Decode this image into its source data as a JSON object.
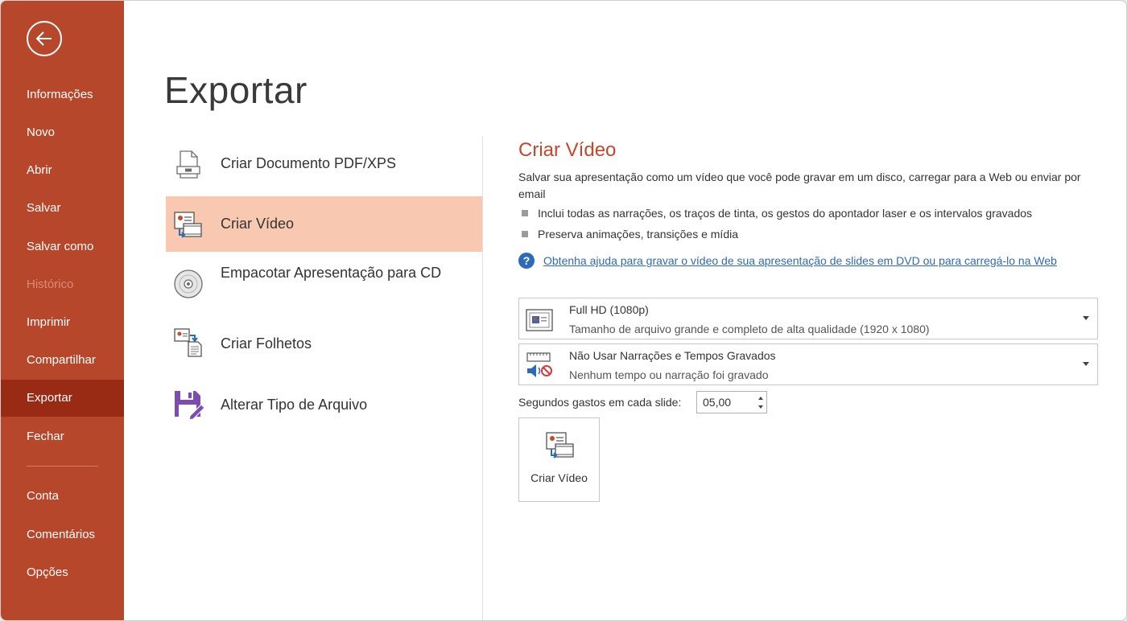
{
  "sidebar": {
    "items": [
      {
        "label": "Informações",
        "state": "normal"
      },
      {
        "label": "Novo",
        "state": "normal"
      },
      {
        "label": "Abrir",
        "state": "normal"
      },
      {
        "label": "Salvar",
        "state": "normal"
      },
      {
        "label": "Salvar como",
        "state": "normal"
      },
      {
        "label": "Histórico",
        "state": "disabled"
      },
      {
        "label": "Imprimir",
        "state": "normal"
      },
      {
        "label": "Compartilhar",
        "state": "normal"
      },
      {
        "label": "Exportar",
        "state": "active"
      },
      {
        "label": "Fechar",
        "state": "normal"
      },
      {
        "label": "Conta",
        "state": "normal"
      },
      {
        "label": "Comentários",
        "state": "normal"
      },
      {
        "label": "Opções",
        "state": "normal"
      }
    ]
  },
  "page": {
    "title": "Exportar"
  },
  "export_options": [
    {
      "label": "Criar Documento PDF/XPS",
      "icon": "pdf-document-icon"
    },
    {
      "label": "Criar Vídeo",
      "icon": "create-video-icon",
      "selected": true
    },
    {
      "label": "Empacotar Apresentação para CD",
      "icon": "cd-icon"
    },
    {
      "label": "Criar Folhetos",
      "icon": "handouts-icon"
    },
    {
      "label": "Alterar Tipo de Arquivo",
      "icon": "change-file-type-icon"
    }
  ],
  "panel": {
    "title": "Criar Vídeo",
    "description": "Salvar sua apresentação como um vídeo que você pode gravar em um disco, carregar para a Web ou enviar por email",
    "bullets": [
      "Inclui todas as narrações, os traços de tinta, os gestos do apontador laser e os intervalos gravados",
      "Preserva animações, transições e mídia"
    ],
    "help_link": "Obtenha ajuda para gravar o vídeo de sua apresentação de slides em DVD ou para carregá-lo na Web",
    "quality": {
      "title": "Full HD (1080p)",
      "subtitle": "Tamanho de arquivo grande e completo de alta qualidade (1920 x 1080)"
    },
    "narration": {
      "title": "Não Usar Narrações e Tempos Gravados",
      "subtitle": "Nenhum tempo ou narração foi gravado"
    },
    "seconds_label": "Segundos gastos em cada slide:",
    "seconds_value": "05,00",
    "create_button": "Criar Vídeo"
  },
  "colors": {
    "brand": "#b7472a",
    "active_nav": "#992b15",
    "selected_option": "#f9c8b1",
    "accent_title": "#c7462a",
    "link": "#2d6ab8"
  }
}
